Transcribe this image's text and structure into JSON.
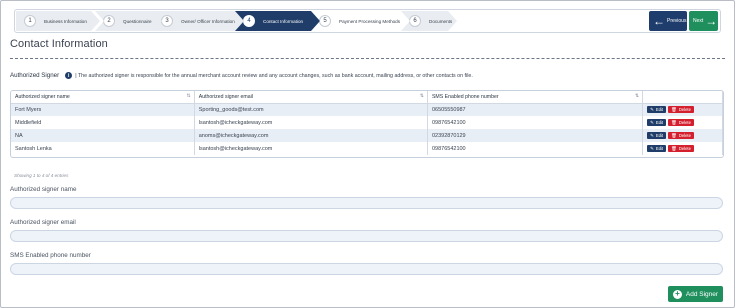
{
  "wizard": {
    "steps": [
      {
        "num": "1",
        "label": "Business Information"
      },
      {
        "num": "2",
        "label": "Questionnaire"
      },
      {
        "num": "3",
        "label": "Owner/ Officer Information"
      },
      {
        "num": "4",
        "label": "Contact Information"
      },
      {
        "num": "5",
        "label": "Payment Processing Methods"
      },
      {
        "num": "6",
        "label": "Documents"
      }
    ],
    "active_step": 4,
    "previous_label": "Previous",
    "next_label": "Next"
  },
  "page": {
    "title": "Contact Information"
  },
  "signer_section": {
    "heading": "Authorized Signer",
    "info_icon": "info-icon",
    "description": "| The authorized signer is responsible for the annual merchant account review and any account changes, such as bank account, mailing address, or other contacts on file."
  },
  "table": {
    "columns": [
      "Authorized signer name",
      "Authorized signer email",
      "SMS Enabled phone number",
      ""
    ],
    "edit_label": "Edit",
    "delete_label": "Delete",
    "rows": [
      {
        "name": "Fort Myers",
        "email": "Sporting_goods@test.com",
        "phone": "06505550987"
      },
      {
        "name": "Middlefield",
        "email": "lsantosh@icheckgateway.com",
        "phone": "09876542100"
      },
      {
        "name": "NA",
        "email": "anoms@icheckgateway.com",
        "phone": "02392870129"
      },
      {
        "name": "Santosh Lenka",
        "email": "lsantosh@icheckgateway.com",
        "phone": "09876542100"
      }
    ],
    "showing_text": "Showing 1 to 4 of 4 entries"
  },
  "form": {
    "name_label": "Authorized signer name",
    "name_value": "",
    "email_label": "Authorized signer email",
    "email_value": "",
    "phone_label": "SMS Enabled phone number",
    "phone_value": ""
  },
  "add_button": {
    "label": "Add Signer"
  },
  "colors": {
    "primary_navy": "#1f3d68",
    "success_green": "#1f8f5e",
    "danger_red": "#d4202e"
  }
}
